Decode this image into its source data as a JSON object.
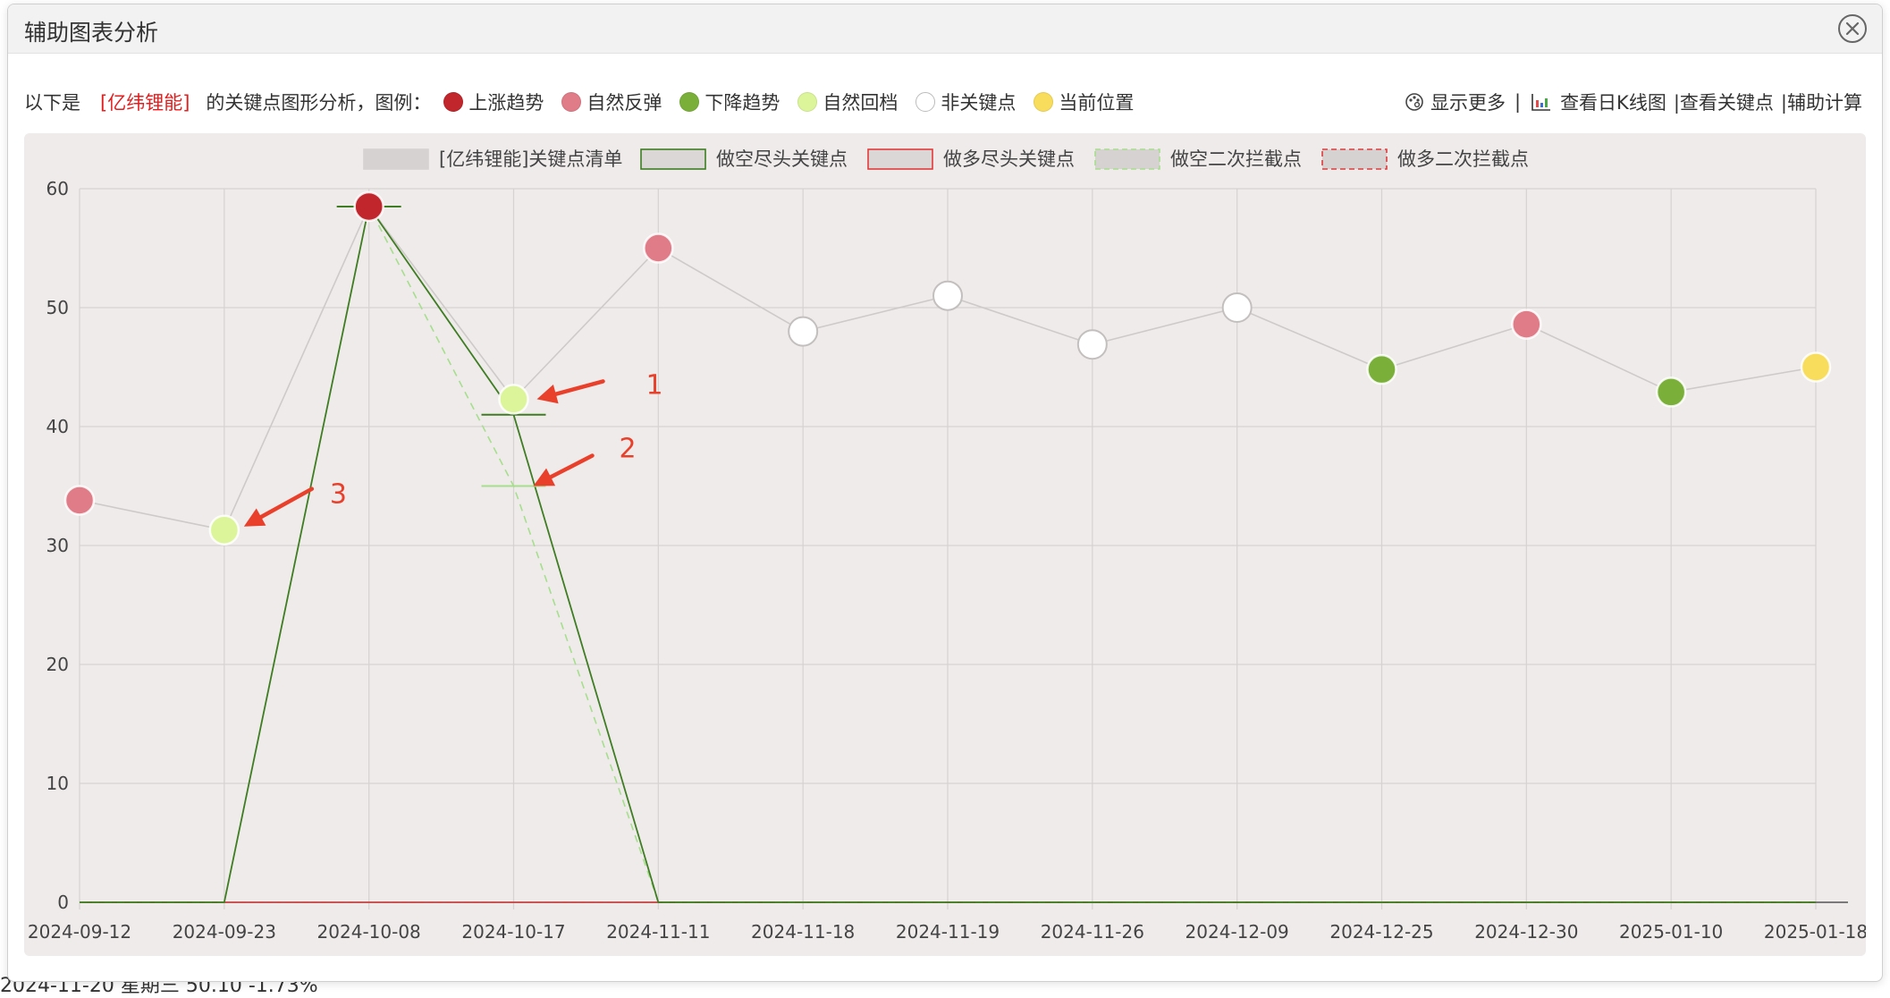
{
  "background": {
    "bottom_text": "2024-11-20   星期三   50.10   -1.73%"
  },
  "dialog": {
    "title": "辅助图表分析",
    "icons": {
      "close": "close-circle-icon",
      "more": "palette-icon",
      "kline": "bar-chart-icon"
    }
  },
  "toolbar": {
    "intro_prefix": "以下是",
    "stock_name": "[亿纬锂能]",
    "intro_suffix": "的关键点图形分析，图例：",
    "legend": [
      {
        "label": "上涨趋势",
        "color": "#c0262c"
      },
      {
        "label": "自然反弹",
        "color": "#e07c88"
      },
      {
        "label": "下降趋势",
        "color": "#7ab03a"
      },
      {
        "label": "自然回档",
        "color": "#dcf59a"
      },
      {
        "label": "非关键点",
        "color": "#ffffff"
      },
      {
        "label": "当前位置",
        "color": "#f8dc5c"
      }
    ],
    "show_more": "显示更多",
    "sep1": "|",
    "view_kline": "查看日K线图",
    "view_keypoints": "|查看关键点",
    "aux_calc": "|辅助计算"
  },
  "chart_data": {
    "type": "line",
    "legend": [
      "[亿纬锂能]关键点清单",
      "做空尽头关键点",
      "做多尽头关键点",
      "做空二次拦截点",
      "做多二次拦截点"
    ],
    "categories": [
      "2024-09-12",
      "2024-09-23",
      "2024-10-08",
      "2024-10-17",
      "2024-11-11",
      "2024-11-18",
      "2024-11-19",
      "2024-11-26",
      "2024-12-09",
      "2024-12-25",
      "2024-12-30",
      "2025-01-10",
      "2025-01-18"
    ],
    "ylim": [
      0,
      60
    ],
    "yticks": [
      0,
      10,
      20,
      30,
      40,
      50,
      60
    ],
    "grid": true,
    "legend_position": "top",
    "series": [
      {
        "name": "[亿纬锂能]关键点清单",
        "values": [
          33.8,
          31.3,
          58.5,
          42.3,
          55.0,
          48.0,
          51.0,
          46.9,
          50.0,
          44.8,
          48.6,
          42.9,
          45.0
        ],
        "point_colors": [
          "#e07c88",
          "#dcf59a",
          "#c0262c",
          "#dcf59a",
          "#e07c88",
          "#ffffff",
          "#ffffff",
          "#ffffff",
          "#ffffff",
          "#7ab03a",
          "#e07c88",
          "#7ab03a",
          "#f8dc5c"
        ]
      },
      {
        "name": "做空尽头关键点",
        "values": [
          0,
          0,
          58.5,
          41.0,
          0,
          0,
          0,
          0,
          0,
          0,
          0,
          0,
          0
        ]
      },
      {
        "name": "做多尽头关键点",
        "values": [
          0,
          0,
          0,
          0,
          0,
          0,
          0,
          0,
          0,
          0,
          0,
          0,
          0
        ]
      },
      {
        "name": "做空二次拦截点",
        "values": [
          0,
          0,
          58.5,
          35.0,
          0,
          0,
          0,
          0,
          0,
          0,
          0,
          0,
          0
        ]
      },
      {
        "name": "做多二次拦截点",
        "values": [
          0,
          0,
          0,
          0,
          0,
          0,
          0,
          0,
          0,
          0,
          0,
          0,
          0
        ]
      }
    ],
    "annotations": [
      {
        "label": "1",
        "x": "2024-10-17",
        "y": 42.3
      },
      {
        "label": "2",
        "x": "2024-10-17",
        "y": 35.0
      },
      {
        "label": "3",
        "x": "2024-09-23",
        "y": 31.3
      }
    ],
    "colors": {
      "keypoint_line": "#cfcaca",
      "short_line": "#3f7d22",
      "short_secondary": "#a6df8c",
      "long_line": "#e23b3b",
      "annotation": "#e8402a",
      "grid": "#d7d2d2"
    }
  }
}
